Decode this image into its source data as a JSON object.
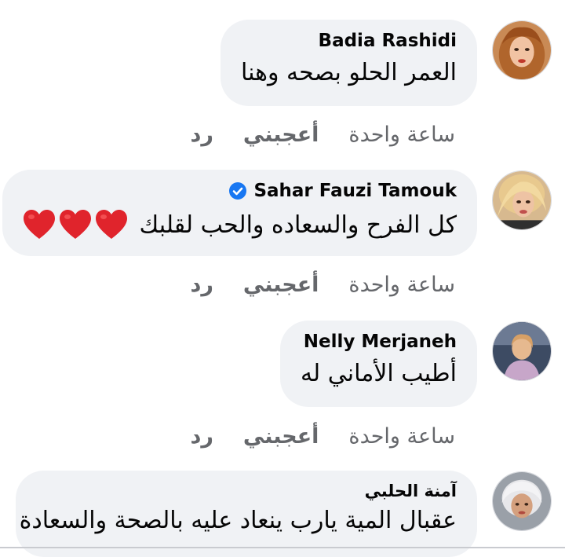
{
  "comments": [
    {
      "author": "Badia Rashidi",
      "text": "العمر الحلو بصحه وهنا",
      "time": "ساعة واحدة",
      "like": "أعجبني",
      "reply": "رد",
      "avatar": "profile-photo-badia"
    },
    {
      "author": "Sahar Fauzi Tamouk",
      "verified": true,
      "text": "كل الفرح والسعاده والحب لقلبك",
      "emoji": [
        "red-heart",
        "red-heart",
        "red-heart"
      ],
      "time": "ساعة واحدة",
      "like": "أعجبني",
      "reply": "رد",
      "avatar": "profile-photo-sahar"
    },
    {
      "author": "Nelly Merjaneh",
      "text": "أطيب الأماني له",
      "time": "ساعة واحدة",
      "like": "أعجبني",
      "reply": "رد",
      "avatar": "profile-photo-nelly"
    },
    {
      "author": "آمنة الحلبي",
      "text": "عقبال المية يارب ينعاد عليه بالصحة والسعادة",
      "avatar": "profile-photo-amna"
    }
  ],
  "colors": {
    "bubble": "#f0f2f5",
    "text": "#050505",
    "secondary": "#65676b",
    "verified": "#1877f2",
    "heart": "#e0242c"
  }
}
